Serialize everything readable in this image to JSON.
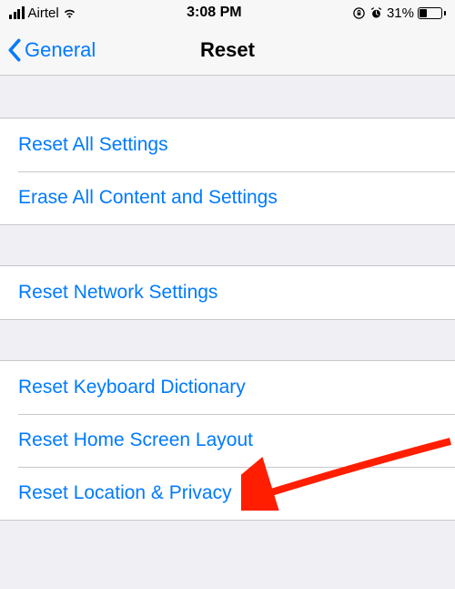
{
  "status": {
    "carrier": "Airtel",
    "time": "3:08 PM",
    "battery_percent": "31%"
  },
  "nav": {
    "back_label": "General",
    "title": "Reset"
  },
  "groups": [
    {
      "items": [
        {
          "label": "Reset All Settings"
        },
        {
          "label": "Erase All Content and Settings"
        }
      ]
    },
    {
      "items": [
        {
          "label": "Reset Network Settings"
        }
      ]
    },
    {
      "items": [
        {
          "label": "Reset Keyboard Dictionary"
        },
        {
          "label": "Reset Home Screen Layout"
        },
        {
          "label": "Reset Location & Privacy"
        }
      ]
    }
  ]
}
